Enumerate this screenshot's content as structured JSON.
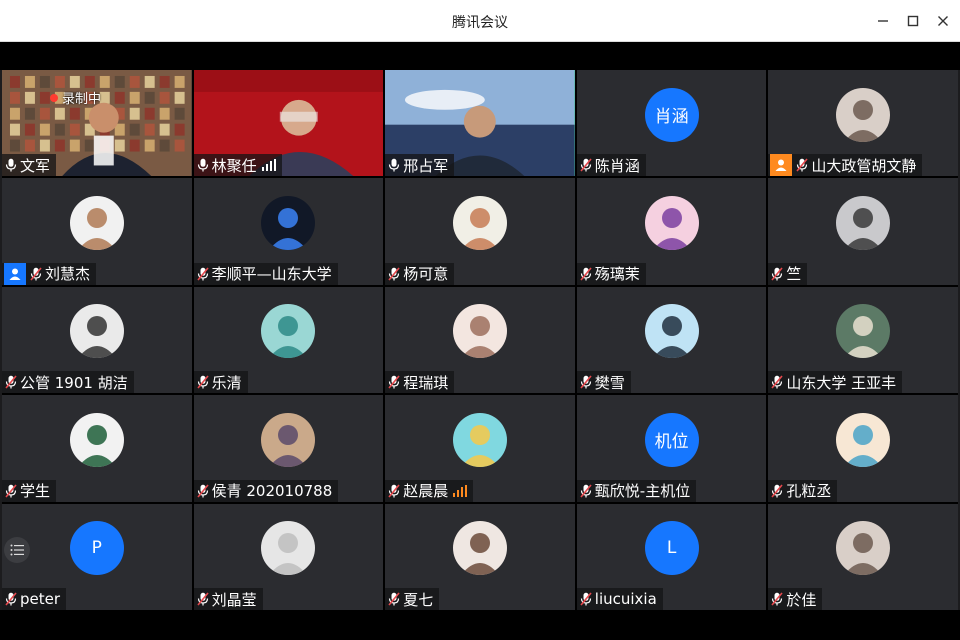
{
  "window": {
    "title": "腾讯会议"
  },
  "recording_label": "录制中",
  "participants": [
    {
      "name": "文军",
      "kind": "video",
      "scene": "library",
      "muted": false
    },
    {
      "name": "林聚任",
      "kind": "video",
      "scene": "red-banner",
      "muted": false,
      "signal": true
    },
    {
      "name": "邢占军",
      "kind": "video",
      "scene": "sky",
      "muted": false,
      "speaking": true
    },
    {
      "name": "陈肖涵",
      "kind": "text",
      "initials": "肖涵",
      "muted": true
    },
    {
      "name": "山大政管胡文静",
      "kind": "photo",
      "muted": true,
      "person_badge": "orange"
    },
    {
      "name": "刘慧杰",
      "kind": "photo",
      "muted": true,
      "person_badge": "blue"
    },
    {
      "name": "李顺平—山东大学",
      "kind": "photo",
      "muted": true
    },
    {
      "name": "杨可意",
      "kind": "photo",
      "muted": true
    },
    {
      "name": "殇璃茉",
      "kind": "photo",
      "muted": true
    },
    {
      "name": "竺",
      "kind": "photo",
      "muted": true
    },
    {
      "name": "公管 1901 胡洁",
      "kind": "photo",
      "muted": true
    },
    {
      "name": "乐清",
      "kind": "photo",
      "muted": true
    },
    {
      "name": "程瑞琪",
      "kind": "photo",
      "muted": true
    },
    {
      "name": "樊雪",
      "kind": "photo",
      "muted": true
    },
    {
      "name": "山东大学 王亚丰",
      "kind": "photo",
      "muted": true
    },
    {
      "name": "学生",
      "kind": "photo",
      "muted": true
    },
    {
      "name": "侯青 202010788",
      "kind": "photo",
      "muted": true
    },
    {
      "name": "赵晨晨",
      "kind": "photo",
      "muted": true,
      "signal": true,
      "signal_color": "orange"
    },
    {
      "name": "甄欣悦-主机位",
      "kind": "text",
      "initials": "机位",
      "muted": true
    },
    {
      "name": "孔粒丞",
      "kind": "photo",
      "muted": true
    },
    {
      "name": "peter",
      "kind": "text",
      "initials": "P",
      "muted": true
    },
    {
      "name": "刘晶莹",
      "kind": "photo",
      "muted": true
    },
    {
      "name": "夏七",
      "kind": "photo",
      "muted": true
    },
    {
      "name": "liucuixia",
      "kind": "text",
      "initials": "L",
      "muted": true
    },
    {
      "name": "於佳",
      "kind": "photo",
      "muted": true
    }
  ],
  "colors": {
    "accent": "#1677ff",
    "speaking": "#2ec27e",
    "muted_mic": "#e5484d",
    "recording": "#ff3b30"
  },
  "icons": {
    "minimize": "minimize-icon",
    "maximize": "maximize-icon",
    "close": "close-icon",
    "menu": "list-menu-icon"
  }
}
